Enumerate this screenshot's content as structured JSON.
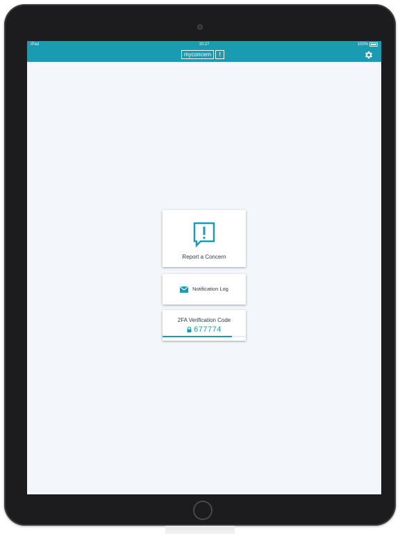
{
  "status_bar": {
    "device": "iPad",
    "time": "10:27",
    "battery": "100%"
  },
  "header": {
    "logo_text": "myconcern",
    "logo_mark": "!",
    "settings_icon": "gear-icon"
  },
  "cards": {
    "report": {
      "label": "Report a Concern",
      "icon": "exclamation-speech-icon"
    },
    "notifications": {
      "label": "Notification Log",
      "icon": "envelope-icon"
    },
    "two_factor": {
      "title": "2FA Verification Code",
      "code": "677774",
      "icon": "lock-icon",
      "progress": 0.83
    }
  },
  "colors": {
    "accent": "#1a9bb1",
    "background": "#f3f7fb",
    "text": "#2d3a44",
    "device_frame": "#1c1c1e"
  }
}
